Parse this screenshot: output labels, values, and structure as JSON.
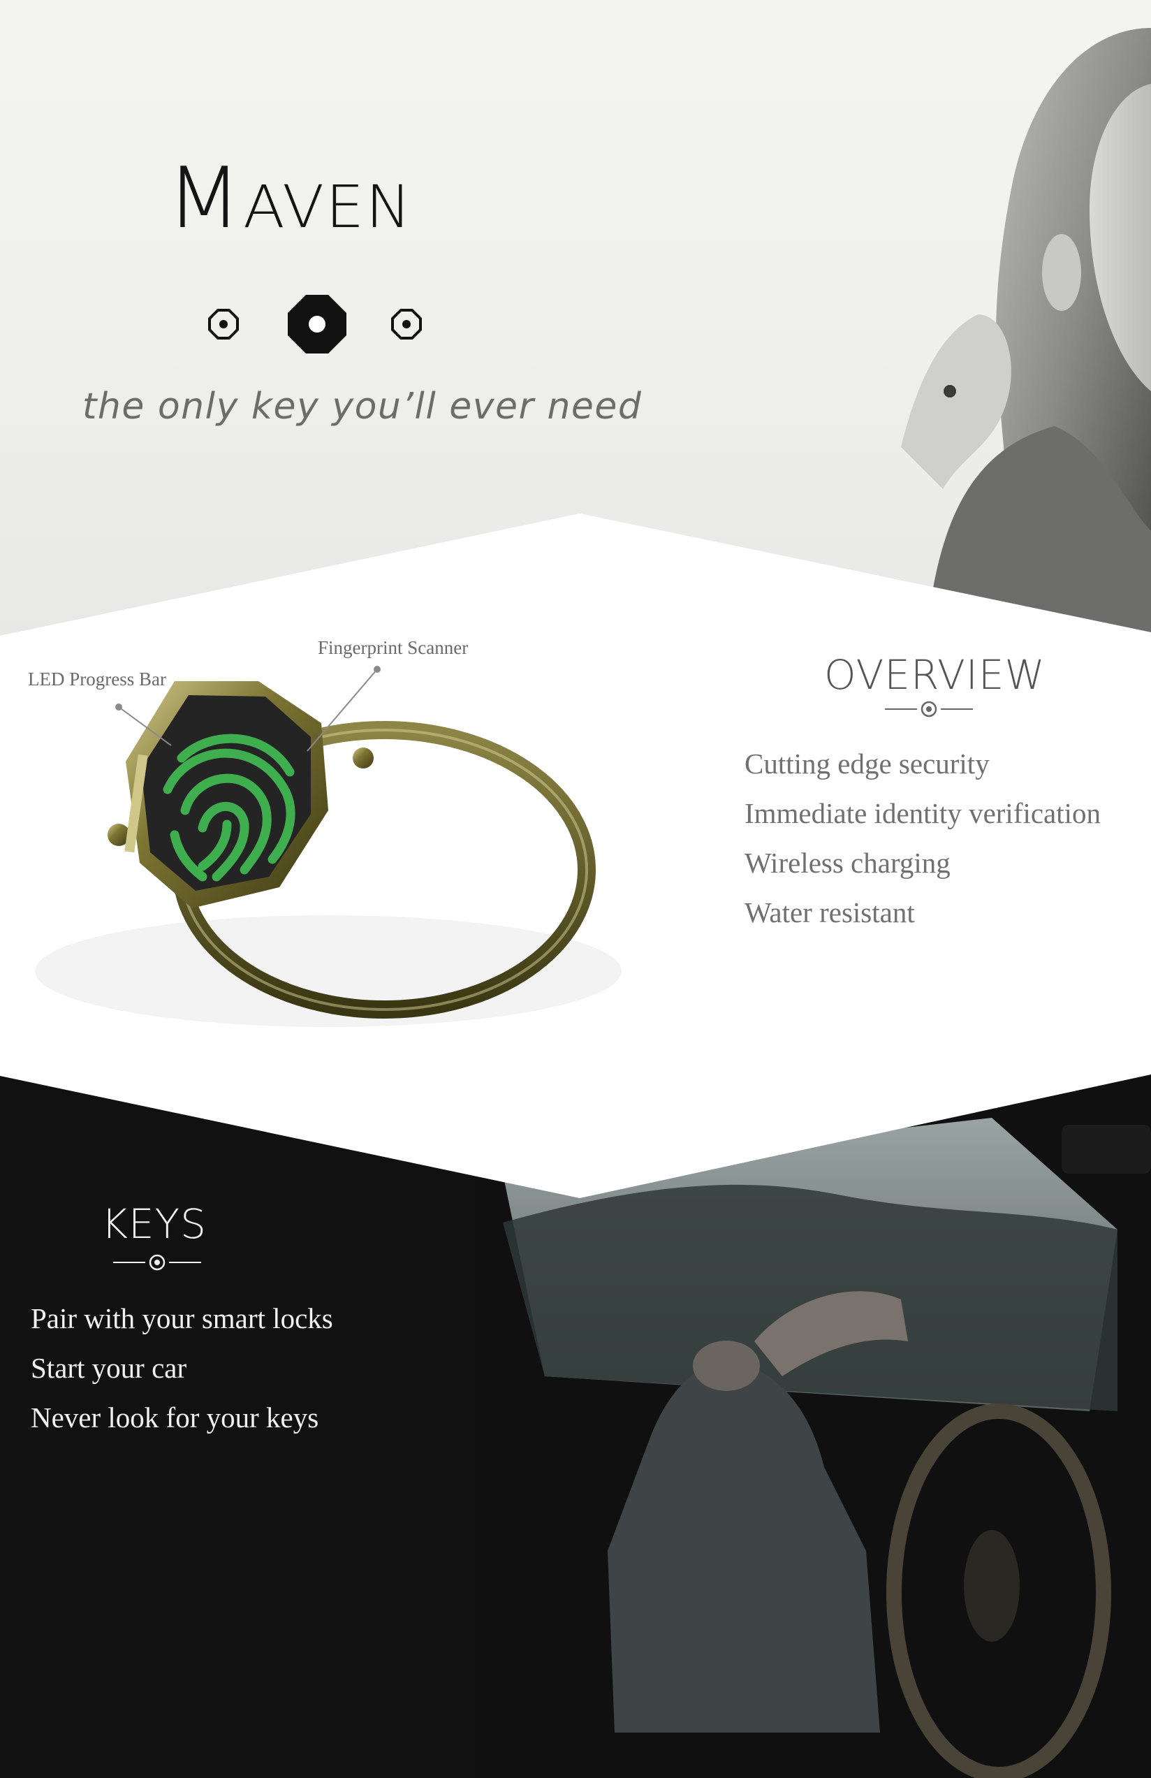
{
  "hero": {
    "title": "Maven",
    "tagline": "the only key you’ll ever need",
    "icons": [
      "octagon-dot-icon",
      "octagon-dot-icon",
      "octagon-dot-icon"
    ]
  },
  "product": {
    "labels": {
      "led": "LED Progress Bar",
      "scanner": "Fingerprint Scanner"
    }
  },
  "overview": {
    "heading": "OVERVIEW",
    "items": [
      "Cutting edge security",
      "Immediate identity verification",
      "Wireless charging",
      "Water resistant"
    ]
  },
  "keys": {
    "heading": "KEYS",
    "items": [
      "Pair with your smart locks",
      "Start your car",
      "Never look for your keys"
    ]
  },
  "colors": {
    "accent_green": "#3fae4f",
    "ring_gold": "#6e6a2c",
    "dark": "#101010"
  }
}
